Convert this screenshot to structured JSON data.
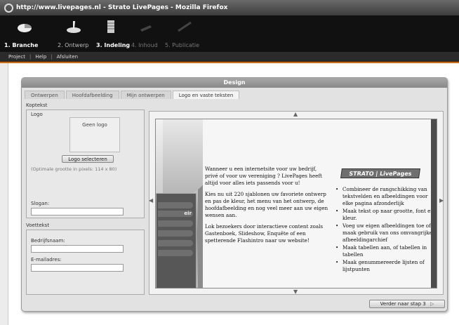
{
  "window": {
    "title": "http://www.livepages.nl - Strato LivePages - Mozilla Firefox"
  },
  "steps": [
    {
      "label": "1. Branche",
      "icon": "pie-icon",
      "state": "active"
    },
    {
      "label": "2. Ontwerp",
      "icon": "paint-brush-icon",
      "state": "done"
    },
    {
      "label": "3. Indeling",
      "icon": "layout-icon",
      "state": "active"
    },
    {
      "label": "4. Inhoud",
      "icon": "edit-icon",
      "state": "inactive"
    },
    {
      "label": "5. Publicatie",
      "icon": "globe-icon",
      "state": "inactive"
    }
  ],
  "menu": {
    "project": "Project",
    "help": "Help",
    "exit": "Afsluiten"
  },
  "panel": {
    "title": "Design",
    "tabs": [
      "Ontwerpen",
      "Hoofdafbeelding",
      "Mijn ontwerpen",
      "Logo en vaste teksten"
    ],
    "selected_tab": "Logo en vaste teksten"
  },
  "header_section": {
    "label": "Koptekst",
    "logo_label": "Logo",
    "logo_placeholder": "Geen logo",
    "select_logo_button": "Logo selecteren",
    "hint": "(Optimale grootte in pixels: 114 x 80)",
    "slogan_label": "Slogan:",
    "slogan_value": ""
  },
  "footer_section": {
    "label": "Voettekst",
    "company_label": "Bedrijfsnaam:",
    "company_value": "",
    "email_label": "E-mailadres:",
    "email_value": ""
  },
  "preview": {
    "nav_item": "eir",
    "paragraphs": [
      "Wanneer u een internetsite voor uw bedrijf, privé of voor uw vereniging ? LivePages heeft altijd voor alles iets passends voor u!",
      "Kies nu uit 220 sjablonen uw favoriete ontwerp en pas de kleur, het menu van het ontwerp, de hoofdafbeelding en nog veel meer aan uw eigen wensen aan.",
      "Lok bezoekers door interactieve content zoals Gastenboek, Slideshow, Enquête of een spetterende Flashintro naar uw website!"
    ],
    "badge": "STRATO | LivePages",
    "bullets": [
      "Combineer de rangschikking van tekstvelden en afbeeldingen voor elke pagina afzonderlijk",
      "Maak tekst op naar grootte, font en kleur.",
      "Voeg uw eigen afbeeldingen toe of maak gebruik van ons omvangrijke afbeeldingarchief",
      "Maak tabellen aan, of tabellen in tabellen",
      "Maak genummereerde lijsten of lijstpunten"
    ]
  },
  "next_button": "Verder naar stap 3"
}
